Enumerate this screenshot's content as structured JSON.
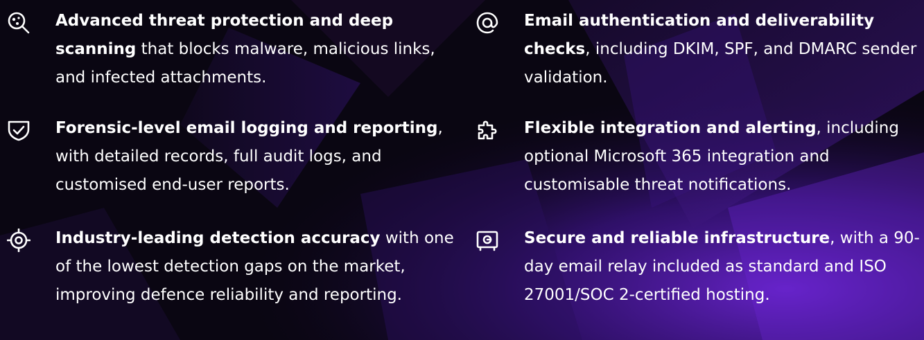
{
  "features": [
    {
      "icon": "virus-scan-icon",
      "bold": "Advanced threat protection and deep scanning",
      "rest": " that blocks malware, malicious links, and infected attachments."
    },
    {
      "icon": "shield-check-icon",
      "bold": "Forensic-level email logging and reporting",
      "rest": ", with detailed records, full audit logs, and customised end-user reports."
    },
    {
      "icon": "target-crosshair-icon",
      "bold": "Industry-leading detection accuracy",
      "rest": " with one of the lowest detection gaps on the market, improving defence reliability and reporting."
    },
    {
      "icon": "at-sign-icon",
      "bold": "Email authentication and deliverability checks",
      "rest": ", including DKIM, SPF, and DMARC sender validation."
    },
    {
      "icon": "puzzle-piece-icon",
      "bold": "Flexible integration and alerting",
      "rest": ", including optional Microsoft 365 integration and customisable threat notifications."
    },
    {
      "icon": "vault-safe-icon",
      "bold": "Secure and reliable infrastructure",
      "rest": ", with a 90-day email relay included as standard and ISO 27001/SOC 2-certified hosting."
    }
  ],
  "colors": {
    "background": "#0a0612",
    "accent_purple": "#5a1fb0",
    "text": "#ffffff"
  }
}
